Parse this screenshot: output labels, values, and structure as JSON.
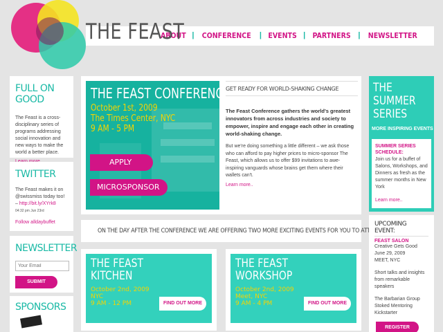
{
  "site": {
    "title": "THE FEAST"
  },
  "nav": {
    "items": [
      "ABOUT",
      "CONFERENCE",
      "EVENTS",
      "PARTNERS",
      "NEWSLETTER"
    ]
  },
  "full_on_good": {
    "heading": "FULL ON GOOD",
    "body": "The Feast is a cross-disciplinary series of programs addressing social innovation and new ways to make the world a better place.",
    "more": "Learn more.."
  },
  "twitter": {
    "heading": "TWITTER",
    "tweet": "The Feast makes it on @swissmiss today too! –",
    "link": "http://bit.ly/XYrk8",
    "time": "04:32 pm Jun 23rd",
    "follow": "Follow alldaybuffet"
  },
  "newsletter": {
    "heading": "NEWSLETTER",
    "placeholder": "Your Email",
    "submit": "SUBMIT"
  },
  "sponsors": {
    "heading": "SPONSORS"
  },
  "conference": {
    "title": "THE FEAST CONFERENCE",
    "date": "October 1st, 2009",
    "venue": "The Times Center, NYC",
    "time": "9 AM - 5 PM",
    "apply": "APPLY",
    "microsponsor": "MICROSPONSOR",
    "kicker": "GET READY FOR WORLD-SHAKING CHANGE",
    "lead": "The Feast Conference gathers the world's greatest innovators from across industries and society to empower, inspire and engage each other in creating world-shaking change.",
    "para": "But we're doing something a little different – we ask those who can afford to pay higher prices to micro-sponsor The Feast, which allows us to offer $99 invitations to awe-inspiring vanguards whose brains get them where their wallets can't.",
    "more": "Learn more.."
  },
  "day_after": {
    "text": "ON THE DAY AFTER THE CONFERENCE WE ARE OFFERING TWO MORE EXCITING EVENTS FOR YOU TO ATTEND:"
  },
  "events": [
    {
      "title1": "THE FEAST",
      "title2": "KITCHEN",
      "date": "October 2nd, 2009",
      "venue": "NYC",
      "time": "9 AM - 12 PM",
      "button": "FIND OUT MORE"
    },
    {
      "title1": "THE FEAST",
      "title2": "WORKSHOP",
      "date": "October 2nd, 2009",
      "venue": "Meet, NYC",
      "time": "9 AM - 4 PM",
      "button": "FIND OUT MORE"
    }
  ],
  "summer": {
    "title1": "THE",
    "title2": "SUMMER",
    "title3": "SERIES",
    "sub": "MORE INSPIRING EVENTS",
    "card_heading": "SUMMER SERIES SCHEDULE:",
    "card_body": "Join us for a buffet of Salons, Workshops, and Dinners as fresh as the summer months in New York",
    "more": "Learn more.."
  },
  "upcoming": {
    "heading": "UPCOMING EVENT:",
    "event": "FEAST SALON",
    "line1": "Creative Gets Good",
    "line2": "June 29, 2009",
    "line3": "MEET, NYC",
    "desc": "Short talks and insights from remarkable speakers",
    "org": "The Barbarian Group",
    "org2": "Stoked Mentoring",
    "org3": "Kickstarter",
    "register": "REGISTER"
  },
  "colors": {
    "teal": "#19b9a5",
    "pink": "#d21486",
    "yellow": "#f6d400"
  }
}
